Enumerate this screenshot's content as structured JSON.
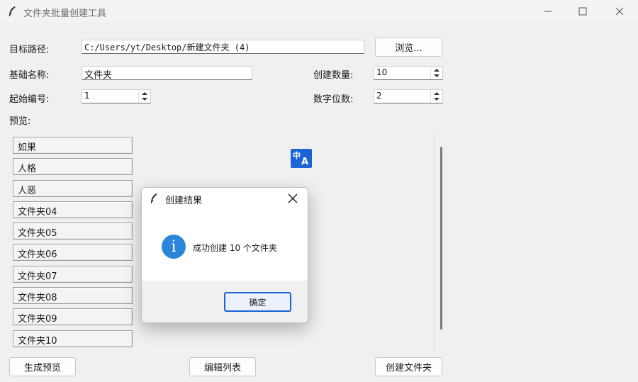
{
  "window": {
    "title": "文件夹批量创建工具"
  },
  "form": {
    "target_path_label": "目标路径:",
    "target_path_value": "C:/Users/yt/Desktop/新建文件夹 (4)",
    "browse_label": "浏览...",
    "base_name_label": "基础名称:",
    "base_name_value": "文件夹",
    "count_label": "创建数量:",
    "count_value": "10",
    "start_label": "起始编号:",
    "start_value": "1",
    "digits_label": "数字位数:",
    "digits_value": "2",
    "preview_label": "预览:"
  },
  "preview_items": [
    "如果",
    "人格",
    "人恶",
    "文件夹04",
    "文件夹05",
    "文件夹06",
    "文件夹07",
    "文件夹08",
    "文件夹09",
    "文件夹10"
  ],
  "buttons": {
    "generate_preview": "生成预览",
    "edit_list": "编辑列表",
    "create_folders": "创建文件夹"
  },
  "translate_icon": {
    "glyph_top": "中",
    "glyph_bottom": "A"
  },
  "dialog": {
    "title": "创建结果",
    "message": "成功创建 10 个文件夹",
    "info_glyph": "i",
    "ok_label": "确定"
  },
  "colors": {
    "accent": "#2b86d9",
    "dialog_ok_border": "#1b64d6"
  }
}
